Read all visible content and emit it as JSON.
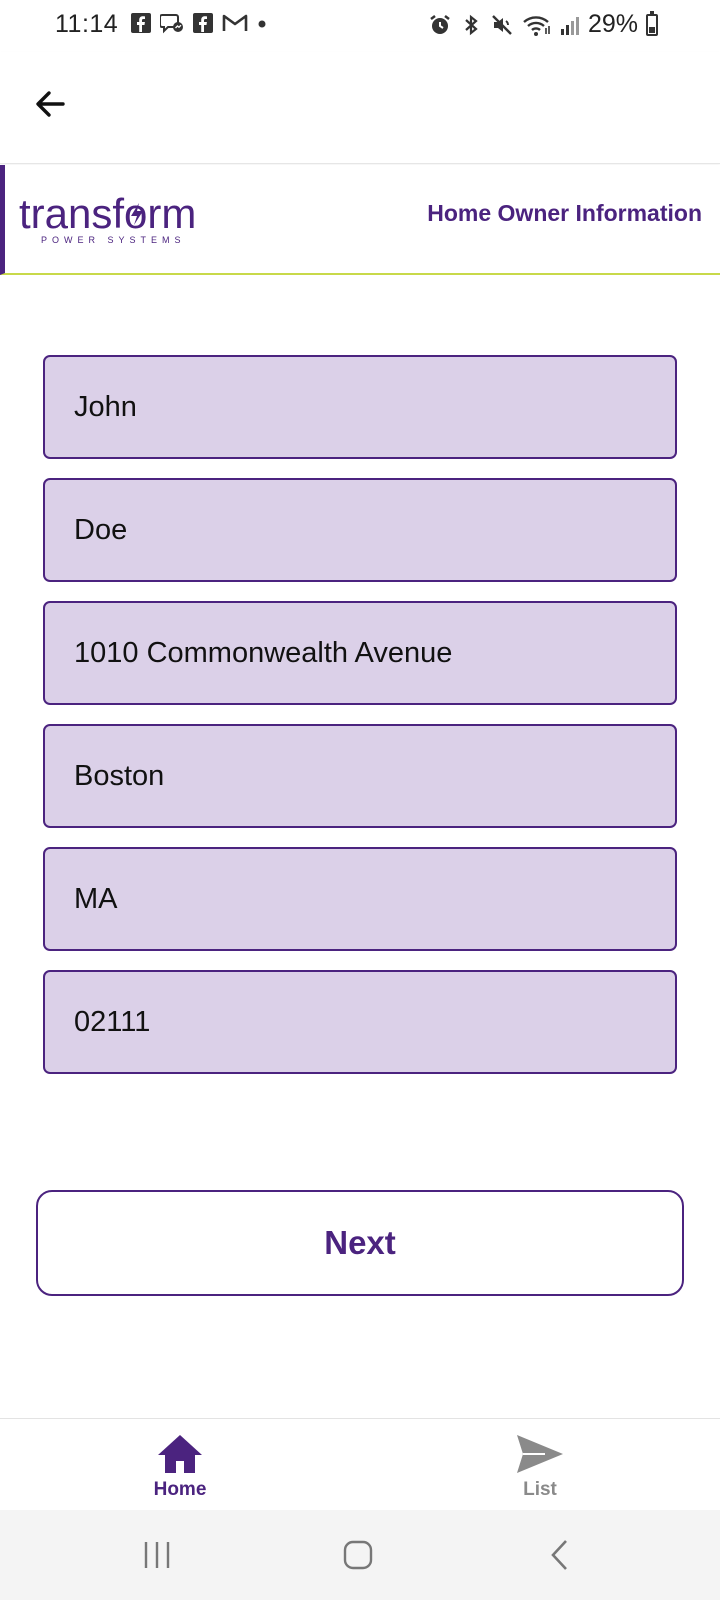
{
  "status_bar": {
    "time": "11:14",
    "battery_text": "29%",
    "left_icons": [
      "facebook-icon",
      "messenger-icon",
      "facebook-icon",
      "gmail-icon",
      "dot-icon"
    ],
    "right_icons": [
      "alarm-icon",
      "bluetooth-icon",
      "mute-icon",
      "wifi-icon",
      "signal-icon",
      "battery-icon"
    ]
  },
  "app_bar": {
    "back_icon": "arrow-left-icon"
  },
  "brand": {
    "logo_word": "transform",
    "logo_sub": "POWER SYSTEMS",
    "title": "Home Owner Information",
    "colors": {
      "primary": "#4b237f",
      "accent_line": "#c8d94a",
      "field_bg": "#dbd0e8"
    }
  },
  "form": {
    "first_name": "John",
    "last_name": "Doe",
    "street": "1010 Commonwealth Avenue",
    "city": "Boston",
    "state": "MA",
    "zip": "02111"
  },
  "actions": {
    "next_label": "Next"
  },
  "bottom_nav": {
    "items": [
      {
        "label": "Home",
        "icon": "home-icon",
        "active": true
      },
      {
        "label": "List",
        "icon": "send-icon",
        "active": false
      }
    ]
  },
  "system_nav": {
    "icons": [
      "recents-icon",
      "home-circle-icon",
      "back-chevron-icon"
    ]
  }
}
